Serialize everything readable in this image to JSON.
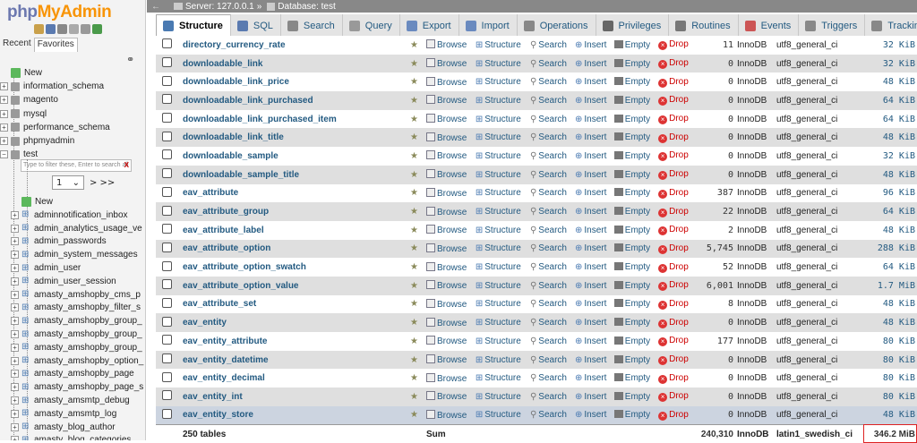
{
  "app": {
    "logo_part1": "php",
    "logo_part2": "MyAdmin"
  },
  "nav": {
    "tabs": [
      "Recent",
      "Favorites"
    ],
    "databases": [
      {
        "label": "New",
        "type": "new"
      },
      {
        "label": "information_schema",
        "type": "db"
      },
      {
        "label": "magento",
        "type": "db"
      },
      {
        "label": "mysql",
        "type": "db"
      },
      {
        "label": "performance_schema",
        "type": "db"
      },
      {
        "label": "phpmyadmin",
        "type": "db"
      },
      {
        "label": "test",
        "type": "db"
      }
    ],
    "filter_placeholder": "Type to filter these, Enter to search all",
    "filter_clear": "X",
    "page_select_value": "1",
    "page_next": "> >>",
    "tables": [
      "New",
      "adminnotification_inbox",
      "admin_analytics_usage_ve",
      "admin_passwords",
      "admin_system_messages",
      "admin_user",
      "admin_user_session",
      "amasty_amshopby_cms_p",
      "amasty_amshopby_filter_s",
      "amasty_amshopby_group_",
      "amasty_amshopby_group_",
      "amasty_amshopby_group_",
      "amasty_amshopby_option_",
      "amasty_amshopby_page",
      "amasty_amshopby_page_s",
      "amasty_amsmtp_debug",
      "amasty_amsmtp_log",
      "amasty_blog_author",
      "amasty_blog_categories"
    ]
  },
  "breadcrumb": {
    "server": "Server: 127.0.0.1",
    "database": "Database: test"
  },
  "tabs": [
    {
      "label": "Structure",
      "active": true,
      "color": "#4a7ab2"
    },
    {
      "label": "SQL",
      "color": "#5a7ab0"
    },
    {
      "label": "Search",
      "color": "#888"
    },
    {
      "label": "Query",
      "color": "#999"
    },
    {
      "label": "Export",
      "color": "#6a8abf"
    },
    {
      "label": "Import",
      "color": "#6a8abf"
    },
    {
      "label": "Operations",
      "color": "#888"
    },
    {
      "label": "Privileges",
      "color": "#666"
    },
    {
      "label": "Routines",
      "color": "#777"
    },
    {
      "label": "Events",
      "color": "#c55"
    },
    {
      "label": "Triggers",
      "color": "#888"
    },
    {
      "label": "Tracking",
      "color": "#888"
    }
  ],
  "actions": {
    "browse": "Browse",
    "structure": "Structure",
    "search": "Search",
    "insert": "Insert",
    "empty": "Empty",
    "drop": "Drop"
  },
  "rows": [
    {
      "name": "directory_currency_rate",
      "rows": "11",
      "engine": "InnoDB",
      "collation": "utf8_general_ci",
      "size": "32 KiB"
    },
    {
      "name": "downloadable_link",
      "rows": "0",
      "engine": "InnoDB",
      "collation": "utf8_general_ci",
      "size": "32 KiB"
    },
    {
      "name": "downloadable_link_price",
      "rows": "0",
      "engine": "InnoDB",
      "collation": "utf8_general_ci",
      "size": "48 KiB"
    },
    {
      "name": "downloadable_link_purchased",
      "rows": "0",
      "engine": "InnoDB",
      "collation": "utf8_general_ci",
      "size": "64 KiB"
    },
    {
      "name": "downloadable_link_purchased_item",
      "rows": "0",
      "engine": "InnoDB",
      "collation": "utf8_general_ci",
      "size": "64 KiB"
    },
    {
      "name": "downloadable_link_title",
      "rows": "0",
      "engine": "InnoDB",
      "collation": "utf8_general_ci",
      "size": "48 KiB"
    },
    {
      "name": "downloadable_sample",
      "rows": "0",
      "engine": "InnoDB",
      "collation": "utf8_general_ci",
      "size": "32 KiB"
    },
    {
      "name": "downloadable_sample_title",
      "rows": "0",
      "engine": "InnoDB",
      "collation": "utf8_general_ci",
      "size": "48 KiB"
    },
    {
      "name": "eav_attribute",
      "rows": "387",
      "engine": "InnoDB",
      "collation": "utf8_general_ci",
      "size": "96 KiB"
    },
    {
      "name": "eav_attribute_group",
      "rows": "22",
      "engine": "InnoDB",
      "collation": "utf8_general_ci",
      "size": "64 KiB"
    },
    {
      "name": "eav_attribute_label",
      "rows": "2",
      "engine": "InnoDB",
      "collation": "utf8_general_ci",
      "size": "48 KiB"
    },
    {
      "name": "eav_attribute_option",
      "rows": "5,745",
      "engine": "InnoDB",
      "collation": "utf8_general_ci",
      "size": "288 KiB"
    },
    {
      "name": "eav_attribute_option_swatch",
      "rows": "52",
      "engine": "InnoDB",
      "collation": "utf8_general_ci",
      "size": "64 KiB"
    },
    {
      "name": "eav_attribute_option_value",
      "rows": "6,001",
      "engine": "InnoDB",
      "collation": "utf8_general_ci",
      "size": "1.7 MiB"
    },
    {
      "name": "eav_attribute_set",
      "rows": "8",
      "engine": "InnoDB",
      "collation": "utf8_general_ci",
      "size": "48 KiB"
    },
    {
      "name": "eav_entity",
      "rows": "0",
      "engine": "InnoDB",
      "collation": "utf8_general_ci",
      "size": "48 KiB"
    },
    {
      "name": "eav_entity_attribute",
      "rows": "177",
      "engine": "InnoDB",
      "collation": "utf8_general_ci",
      "size": "80 KiB"
    },
    {
      "name": "eav_entity_datetime",
      "rows": "0",
      "engine": "InnoDB",
      "collation": "utf8_general_ci",
      "size": "80 KiB"
    },
    {
      "name": "eav_entity_decimal",
      "rows": "0",
      "engine": "InnoDB",
      "collation": "utf8_general_ci",
      "size": "80 KiB"
    },
    {
      "name": "eav_entity_int",
      "rows": "0",
      "engine": "InnoDB",
      "collation": "utf8_general_ci",
      "size": "80 KiB"
    },
    {
      "name": "eav_entity_store",
      "rows": "0",
      "engine": "InnoDB",
      "collation": "utf8_general_ci",
      "size": "48 KiB"
    }
  ],
  "footer": {
    "count": "250 tables",
    "sum_label": "Sum",
    "rows": "240,310",
    "engine": "InnoDB",
    "collation": "latin1_swedish_ci",
    "size": "346.2 MiB"
  },
  "colors": {
    "link": "#235a81",
    "highlight_box": "#d22222",
    "selected_row": "#ccd4e0"
  }
}
